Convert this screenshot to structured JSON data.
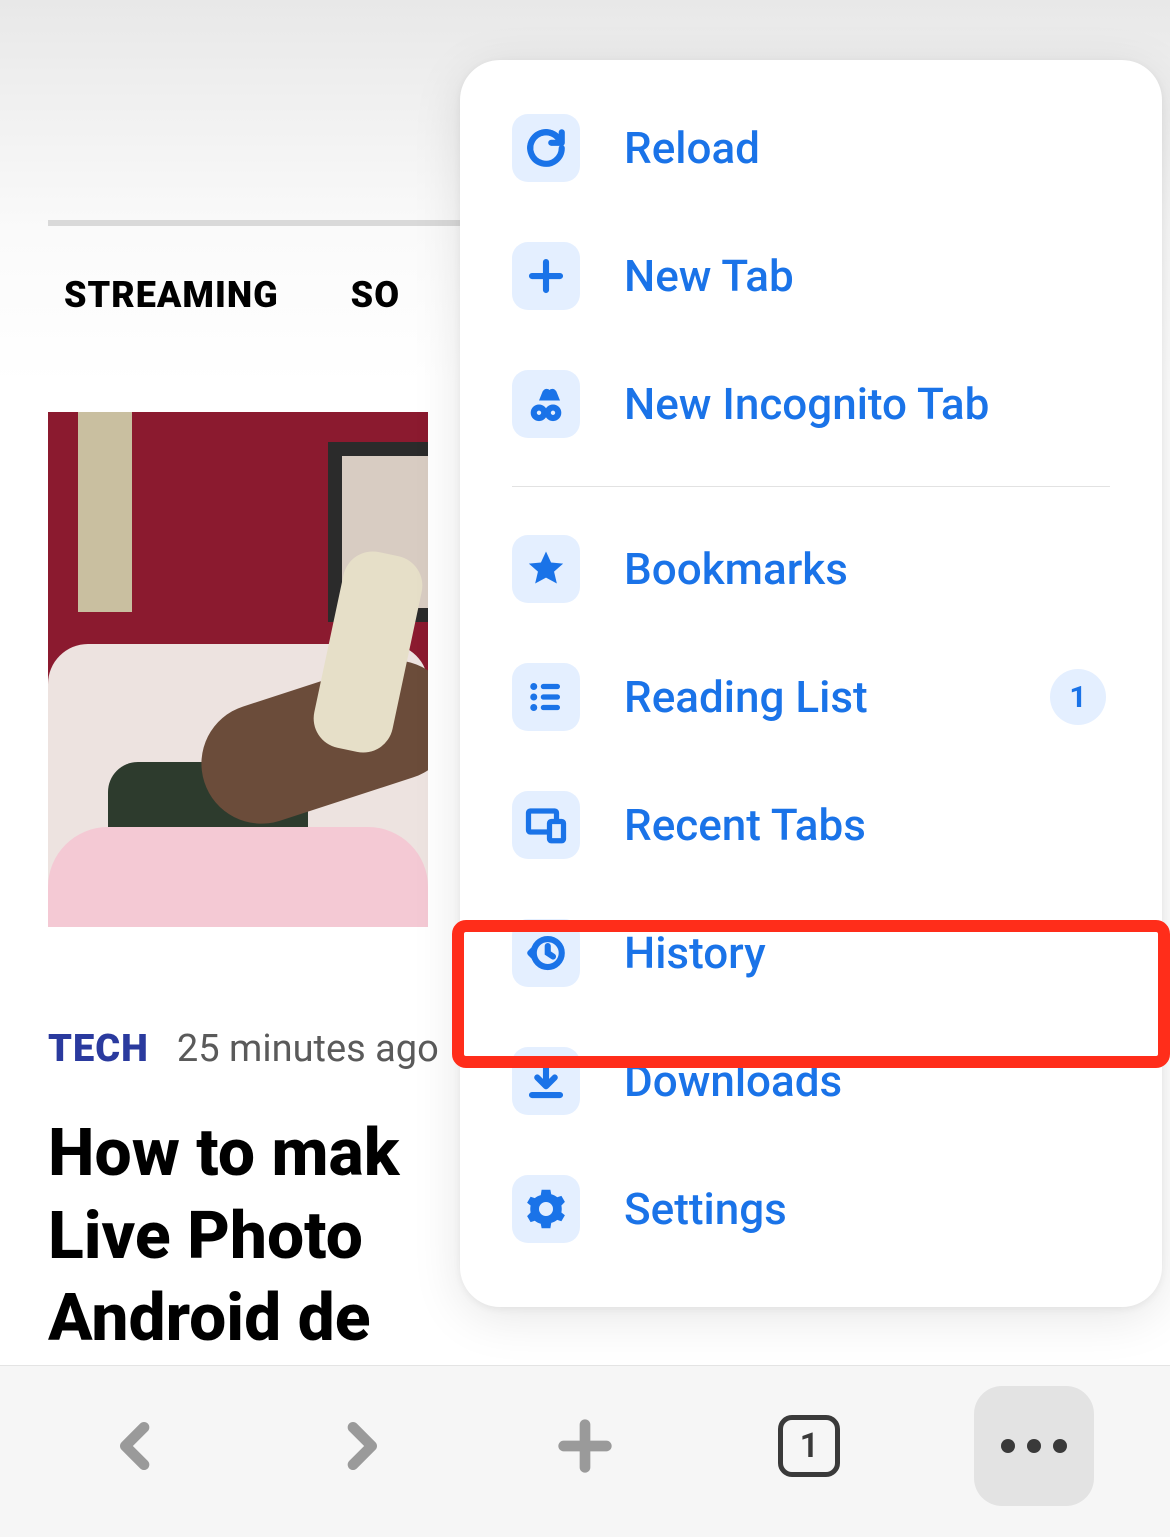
{
  "nav": {
    "tabs": [
      "STREAMING",
      "SO"
    ]
  },
  "article": {
    "category": "TECH",
    "timestamp": "25 minutes ago",
    "headline": "How to mak\nLive Photo\nAndroid de"
  },
  "menu": {
    "items": [
      {
        "icon": "reload",
        "label": "Reload"
      },
      {
        "icon": "plus",
        "label": "New Tab"
      },
      {
        "icon": "incognito",
        "label": "New Incognito Tab"
      }
    ],
    "items2": [
      {
        "icon": "star",
        "label": "Bookmarks"
      },
      {
        "icon": "list",
        "label": "Reading List",
        "badge": "1"
      },
      {
        "icon": "devices",
        "label": "Recent Tabs"
      },
      {
        "icon": "history",
        "label": "History"
      },
      {
        "icon": "download",
        "label": "Downloads"
      },
      {
        "icon": "settings",
        "label": "Settings"
      }
    ]
  },
  "toolbar": {
    "tab_count": "1"
  }
}
